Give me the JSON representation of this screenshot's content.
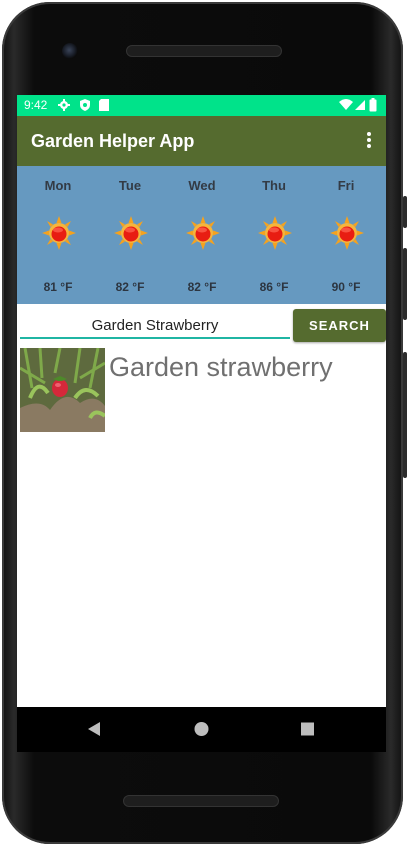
{
  "status_bar": {
    "time": "9:42",
    "color": "#00e38a"
  },
  "app_bar": {
    "title": "Garden Helper App",
    "color": "#556b2f"
  },
  "forecast": [
    {
      "day": "Mon",
      "temp": "81 °F",
      "icon": "sun-icon"
    },
    {
      "day": "Tue",
      "temp": "82 °F",
      "icon": "sun-icon"
    },
    {
      "day": "Wed",
      "temp": "82 °F",
      "icon": "sun-icon"
    },
    {
      "day": "Thu",
      "temp": "86 °F",
      "icon": "sun-icon"
    },
    {
      "day": "Fri",
      "temp": "90 °F",
      "icon": "sun-icon"
    }
  ],
  "search": {
    "value": "Garden Strawberry",
    "button_label": "SEARCH"
  },
  "result": {
    "title": "Garden strawberry",
    "thumbnail": "strawberry-plant-photo"
  },
  "nav": {
    "icons": [
      "back-icon",
      "home-icon",
      "recents-icon"
    ]
  }
}
